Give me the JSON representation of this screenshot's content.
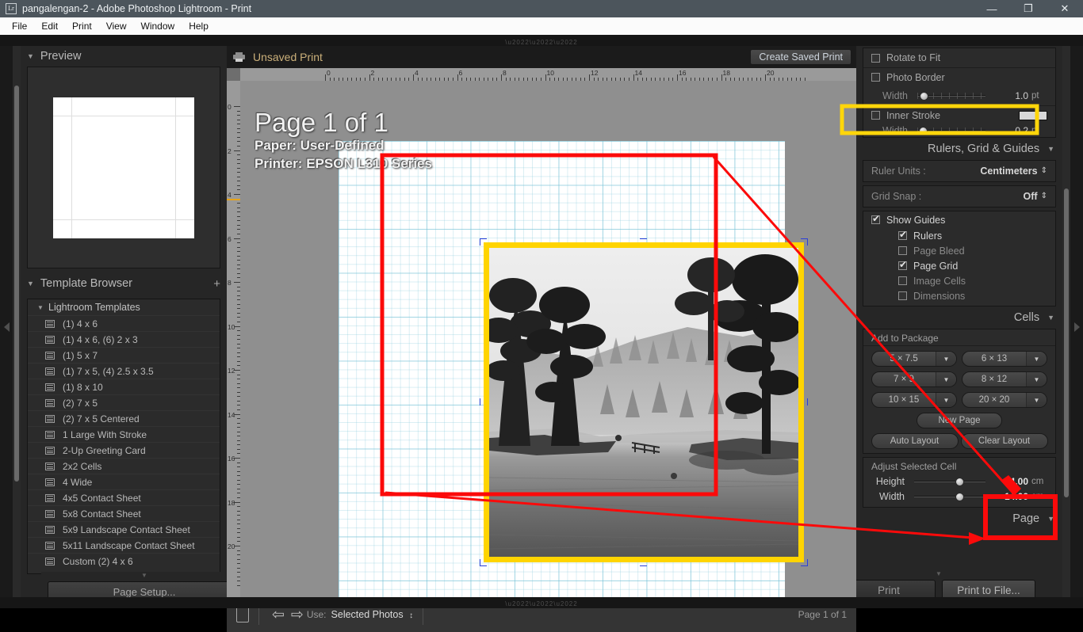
{
  "window": {
    "title": "pangalengan-2 - Adobe Photoshop Lightroom - Print",
    "logo": "Lr",
    "minimize": "—",
    "maximize": "❐",
    "close": "✕"
  },
  "menu": [
    "File",
    "Edit",
    "Print",
    "View",
    "Window",
    "Help"
  ],
  "left": {
    "preview": {
      "title": "Preview",
      "collapse_tri": "▼"
    },
    "template_browser": {
      "title": "Template Browser",
      "collapse_tri": "▼",
      "add_label": "+",
      "group": "Lightroom Templates",
      "group_tri": "▼",
      "items": [
        "(1) 4 x 6",
        "(1) 4 x 6, (6) 2 x 3",
        "(1) 5 x 7",
        "(1) 7 x 5, (4) 2.5 x 3.5",
        "(1) 8 x 10",
        "(2) 7 x 5",
        "(2) 7 x 5 Centered",
        "1 Large With Stroke",
        "2-Up Greeting Card",
        "2x2 Cells",
        "4 Wide",
        "4x5 Contact Sheet",
        "5x8 Contact Sheet",
        "5x9 Landscape Contact Sheet",
        "5x11 Landscape Contact Sheet",
        "Custom (2) 4 x 6"
      ]
    },
    "page_setup_button": "Page Setup..."
  },
  "center": {
    "print_title": "Unsaved Print",
    "create_saved_print": "Create Saved Print",
    "overlay": {
      "page_line": "Page 1 of 1",
      "paper_label": "Paper:",
      "paper_value": "User-Defined",
      "printer_label": "Printer:",
      "printer_value": "EPSON L310 Series"
    },
    "ruler": {
      "units": "cm",
      "h_ticks": [
        0,
        2,
        4,
        6,
        8,
        10,
        12,
        14,
        16,
        18,
        20
      ],
      "v_ticks": [
        0,
        2,
        4,
        6,
        8,
        10,
        12,
        14,
        16,
        18,
        20
      ]
    },
    "toolbar": {
      "use_label": "Use:",
      "use_value": "Selected Photos",
      "stepper": "↕",
      "prev": "⇦",
      "next": "⇨",
      "page_indicator": "Page 1 of 1"
    }
  },
  "right": {
    "image_settings_tail": {
      "rotate_to_fit": "Rotate to Fit",
      "photo_border": "Photo Border",
      "photo_border_width_label": "Width",
      "photo_border_width_value": "1.0",
      "photo_border_width_unit": "pt",
      "inner_stroke": "Inner Stroke",
      "inner_stroke_width_label": "Width",
      "inner_stroke_width_value": "0.2",
      "inner_stroke_width_unit": "pt"
    },
    "rulers_grid_guides": {
      "title": "Rulers, Grid & Guides",
      "collapse_tri": "▼",
      "ruler_units_label": "Ruler Units :",
      "ruler_units_value": "Centimeters",
      "grid_snap_label": "Grid Snap :",
      "grid_snap_value": "Off",
      "show_guides": "Show Guides",
      "guides": [
        {
          "label": "Rulers",
          "checked": true
        },
        {
          "label": "Page Bleed",
          "checked": false
        },
        {
          "label": "Page Grid",
          "checked": true
        },
        {
          "label": "Image Cells",
          "checked": false
        },
        {
          "label": "Dimensions",
          "checked": false
        }
      ]
    },
    "cells": {
      "title": "Cells",
      "collapse_tri": "▼",
      "add_to_package": "Add to Package",
      "size_buttons": [
        "5 × 7.5",
        "6 × 13",
        "7 × 9",
        "8 × 12",
        "10 × 15",
        "20 × 20"
      ],
      "new_page": "New Page",
      "auto_layout": "Auto Layout",
      "clear_layout": "Clear Layout",
      "adjust_selected_cell": "Adjust Selected Cell",
      "height_label": "Height",
      "height_value": "14.00",
      "height_unit": "cm",
      "width_label": "Width",
      "width_value": "14.00",
      "width_unit": "cm"
    },
    "page": {
      "title": "Page",
      "collapse_tri": "▼"
    },
    "print_button": "Print",
    "print_to_file_button": "Print to File..."
  },
  "colors": {
    "annotation_red": "#fb0a0a",
    "annotation_yellow": "#ffd60a",
    "photo_border_yellow": "#ffd400",
    "selection_blue": "#2b3fd8",
    "title_accent": "#cbb07a"
  }
}
